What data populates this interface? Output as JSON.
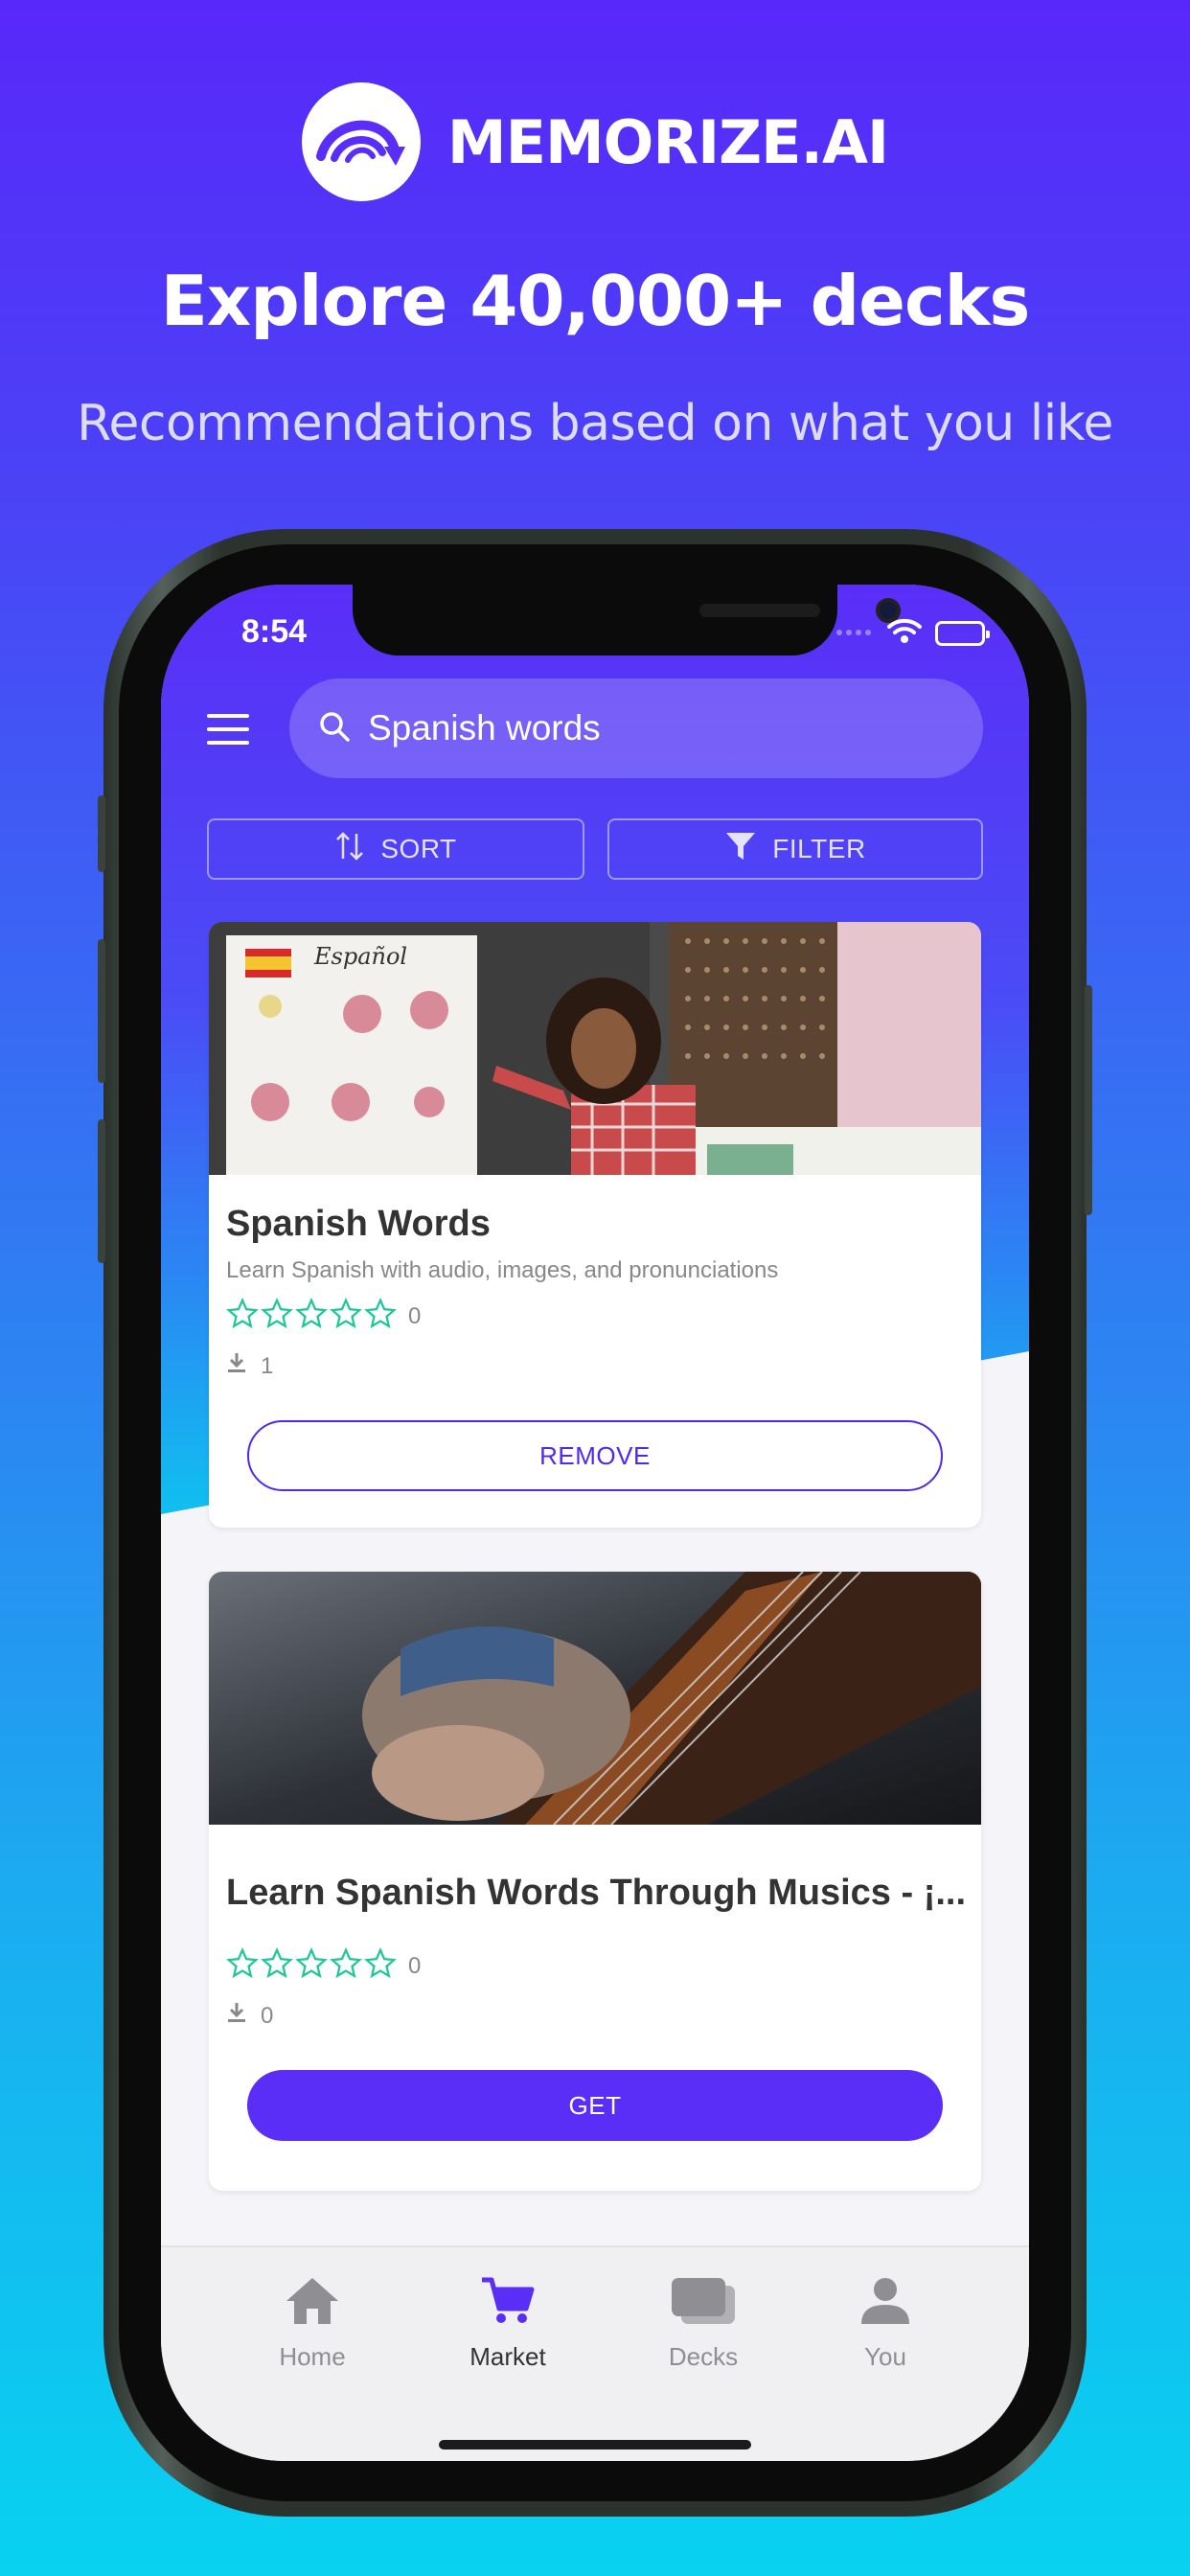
{
  "brand": {
    "name": "MEMORIZE.AI",
    "logo_icon": "memorize-wave-logo-icon",
    "accent": "#5a2ef7"
  },
  "marketing": {
    "headline": "Explore 40,000+ decks",
    "subline": "Recommendations based on what you like"
  },
  "status_bar": {
    "time": "8:54",
    "icons": [
      "signal-icon",
      "wifi-icon",
      "battery-icon"
    ]
  },
  "search": {
    "value": "Spanish words",
    "placeholder": "Search"
  },
  "toolbar": {
    "sort_label": "SORT",
    "filter_label": "FILTER"
  },
  "decks": [
    {
      "title": "Spanish Words",
      "description": "Learn Spanish with audio, images, and pronunciations",
      "rating_count": "0",
      "downloads": "1",
      "action_label": "REMOVE",
      "image_alt": "teacher-with-espanol-poster",
      "poster_title": "Español"
    },
    {
      "title": "Learn Spanish Words Through Musics - ¡...",
      "description": "",
      "rating_count": "0",
      "downloads": "0",
      "action_label": "GET",
      "image_alt": "hand-playing-guitar"
    }
  ],
  "tabs": [
    {
      "label": "Home",
      "icon": "home-icon"
    },
    {
      "label": "Market",
      "icon": "cart-icon",
      "active": true
    },
    {
      "label": "Decks",
      "icon": "cards-stack-icon"
    },
    {
      "label": "You",
      "icon": "person-icon"
    }
  ],
  "colors": {
    "star": "#1ec79a",
    "accent": "#5a2ef7",
    "tab_active": "#5a2ef7",
    "tab_inactive": "#8e8e93"
  }
}
